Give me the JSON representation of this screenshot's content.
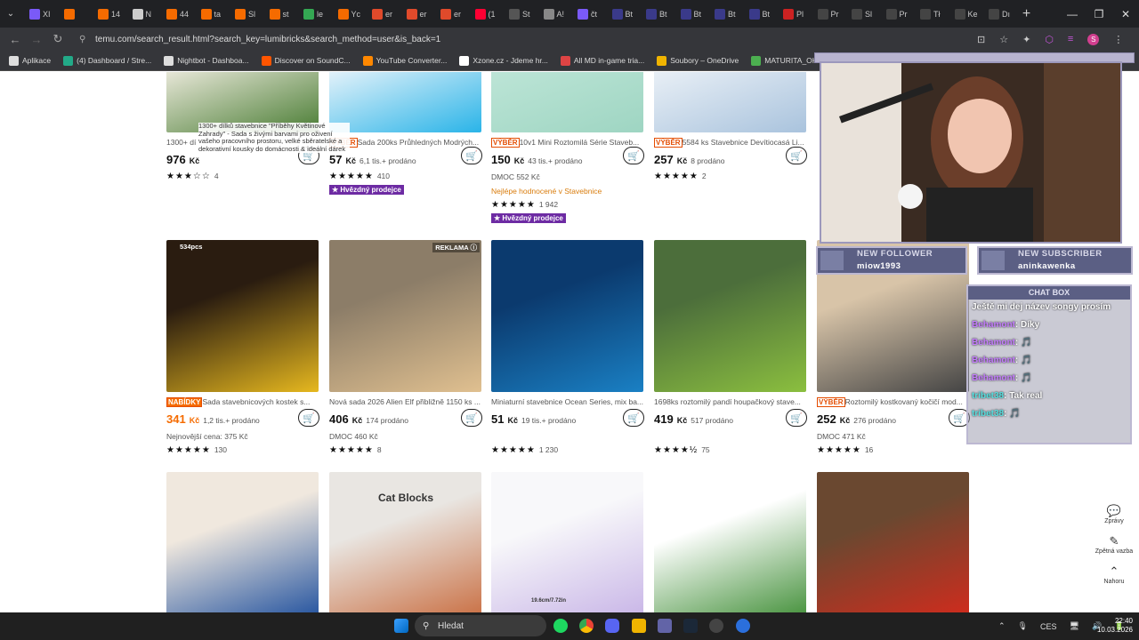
{
  "browser": {
    "tabs": [
      {
        "label": "XI",
        "color": "#7a5af8"
      },
      {
        "label": "",
        "color": "#f56b00"
      },
      {
        "label": "14",
        "color": "#f56b00"
      },
      {
        "label": "N",
        "color": "#cccccc"
      },
      {
        "label": "44",
        "color": "#f56b00"
      },
      {
        "label": "ta",
        "color": "#f56b00"
      },
      {
        "label": "Sl",
        "color": "#f56b00"
      },
      {
        "label": "st",
        "color": "#f56b00"
      },
      {
        "label": "le",
        "color": "#34a853"
      },
      {
        "label": "Yc",
        "color": "#f56b00"
      },
      {
        "label": "er",
        "color": "#e04a2b"
      },
      {
        "label": "er",
        "color": "#e04a2b"
      },
      {
        "label": "er",
        "color": "#e04a2b"
      },
      {
        "label": "(1",
        "color": "#ff0033"
      },
      {
        "label": "St",
        "color": "#555555"
      },
      {
        "label": "A!",
        "color": "#888888"
      },
      {
        "label": "čt",
        "color": "#7a5af8"
      },
      {
        "label": "Bt",
        "color": "#3a3a8a"
      },
      {
        "label": "Bt",
        "color": "#3a3a8a"
      },
      {
        "label": "Bt",
        "color": "#3a3a8a"
      },
      {
        "label": "Bt",
        "color": "#3a3a8a"
      },
      {
        "label": "Bt",
        "color": "#3a3a8a"
      },
      {
        "label": "Pl",
        "color": "#cc2222"
      },
      {
        "label": "Pr",
        "color": "#444444"
      },
      {
        "label": "Sl",
        "color": "#444444"
      },
      {
        "label": "Pr",
        "color": "#444444"
      },
      {
        "label": "Tł",
        "color": "#444444"
      },
      {
        "label": "Ke",
        "color": "#444444"
      },
      {
        "label": "Dı",
        "color": "#444444"
      }
    ],
    "url": "temu.com/search_result.html?search_key=lumibricks&search_method=user&is_back=1",
    "bookmarks": [
      {
        "label": "Aplikace",
        "color": "#dddddd"
      },
      {
        "label": "(4) Dashboard / Stre...",
        "color": "#22aa88"
      },
      {
        "label": "Nightbot - Dashboa...",
        "color": "#dddddd"
      },
      {
        "label": "Discover on SoundC...",
        "color": "#ff5500"
      },
      {
        "label": "YouTube Converter...",
        "color": "#ff8800"
      },
      {
        "label": "Xzone.cz - Jdeme hr...",
        "color": "#ffffff"
      },
      {
        "label": "All MD in-game tria...",
        "color": "#dd4444"
      },
      {
        "label": "Soubory – OneDrive",
        "color": "#f0b400"
      },
      {
        "label": "MATURITA_OKRUH...",
        "color": "#4caf50"
      }
    ]
  },
  "tooltip": {
    "text": "1300+ dílků stavebnice \"Příběhy Květinové Zahrady\" - Sada s živými barvami pro oživení vašeho pracovního prostoru, velké sběratelské a dekorativní kousky do domácnosti & ideální dárek"
  },
  "products_row1": [
    {
      "title": "1300+ dí",
      "tag": "",
      "price": "976",
      "currency": "Kč",
      "sold": "",
      "meta": "",
      "stars": "★★★☆☆",
      "reviews": "4",
      "badge": "",
      "colors": [
        "#f5f0e6",
        "#4a7d34"
      ]
    },
    {
      "title": "Sada 200ks Průhledných Modrých...",
      "tag": "VÝBĚR",
      "price": "57",
      "currency": "Kč",
      "sold": "6,1 tis.+ prodáno",
      "meta": "",
      "stars": "★★★★★",
      "reviews": "410",
      "badge": "★ Hvězdný prodejce",
      "colors": [
        "#f3f7fb",
        "#2ab4e8"
      ]
    },
    {
      "title": "10v1 Mini Roztomilá Série Staveb...",
      "tag": "VÝBĚR",
      "price": "150",
      "currency": "Kč",
      "sold": "43 tis.+ prodáno",
      "meta": "DMOC 552 Kč",
      "meta2": "Nejlépe hodnocené v Stavebnice",
      "stars": "★★★★★",
      "reviews": "1 942",
      "badge": "★ Hvězdný prodejce",
      "colors": [
        "#bfe6d8",
        "#9ed5c2"
      ]
    },
    {
      "title": "5584 ks Stavebnice Devítiocasá Li...",
      "tag": "VÝBĚR",
      "price": "257",
      "currency": "Kč",
      "sold": "8 prodáno",
      "meta": "",
      "stars": "★★★★★",
      "reviews": "2",
      "badge": "",
      "colors": [
        "#eef3f8",
        "#a9c3dd"
      ]
    }
  ],
  "products_row2": [
    {
      "title": "Sada stavebnicových kostek s...",
      "tag": "NABÍDKY",
      "price": "341",
      "currency": "Kč",
      "sold": "1,2 tis.+ prodáno",
      "meta": "Nejnovější cena: 375 Kč",
      "stars": "★★★★★",
      "reviews": "130",
      "overlay": "534pcs",
      "colors": [
        "#2a1c10",
        "#e6b81f"
      ]
    },
    {
      "title": "Nová sada 2026 Alien Elf přibližně 1150 ks ...",
      "tag": "",
      "price": "406",
      "currency": "Kč",
      "sold": "174 prodáno",
      "meta": "DMOC 460 Kč",
      "stars": "★★★★★",
      "reviews": "8",
      "overlay": "REKLAMA ⓘ",
      "colors": [
        "#8c7d68",
        "#e0c090"
      ]
    },
    {
      "title": "Miniaturní stavebnice Ocean Series, mix ba...",
      "tag": "",
      "price": "51",
      "currency": "Kč",
      "sold": "19 tis.+ prodáno",
      "meta": "",
      "stars": "★★★★★",
      "reviews": "1 230",
      "overlay": "",
      "colors": [
        "#0b3a6e",
        "#1a80c4"
      ]
    },
    {
      "title": "1698ks roztomilý pandí houpačkový stave...",
      "tag": "",
      "price": "419",
      "currency": "Kč",
      "sold": "517 prodáno",
      "meta": "",
      "stars": "★★★★½",
      "reviews": "75",
      "overlay": "",
      "colors": [
        "#4c6e3b",
        "#8bbf3f"
      ]
    },
    {
      "title": "Roztomilý kostkovaný kočičí mod...",
      "tag": "VÝBĚR",
      "price": "252",
      "currency": "Kč",
      "sold": "276 prodáno",
      "meta": "DMOC 471 Kč",
      "stars": "★★★★★",
      "reviews": "16",
      "overlay": "",
      "colors": [
        "#d8c4a8",
        "#444444"
      ]
    }
  ],
  "products_row3": [
    {
      "colors": [
        "#f0e8de",
        "#1a4c9c"
      ]
    },
    {
      "colors": [
        "#e9e6e2",
        "#c86a3c"
      ],
      "label": "Cat Blocks"
    },
    {
      "colors": [
        "#f8f8fa",
        "#c6b2e6"
      ],
      "dim_top": "19.6cm/7.72in"
    },
    {
      "colors": [
        "#ffffff",
        "#3c8c32"
      ]
    },
    {
      "colors": [
        "#6a4830",
        "#d62a1c"
      ]
    }
  ],
  "stream": {
    "follower_label": "NEW FOLLOWER",
    "follower_name": "miow1993",
    "subscriber_label": "NEW SUBSCRIBER",
    "subscriber_name": "aninkawenka",
    "chat_title": "CHAT BOX",
    "messages": [
      {
        "user": "",
        "text": "Ještě mi dej název songy prosím"
      },
      {
        "user": "Behamont",
        "text": ": Díky"
      },
      {
        "user": "Behamont",
        "text": ": 🎵"
      },
      {
        "user": "Behamont",
        "text": ": 🎵"
      },
      {
        "user": "Behamont",
        "text": ": 🎵"
      },
      {
        "user": "tribet38",
        "text": ": Tak real"
      },
      {
        "user": "tribet38",
        "text": ": 🎵"
      }
    ]
  },
  "side_buttons": [
    {
      "label": "Zprávy",
      "icon": "💬"
    },
    {
      "label": "Zpětná vazba",
      "icon": "✎"
    },
    {
      "label": "Nahoru",
      "icon": "⌃"
    }
  ],
  "taskbar": {
    "search_label": "Hledat",
    "lang": "CES",
    "time": "22:40",
    "date": "10.03.2026"
  }
}
